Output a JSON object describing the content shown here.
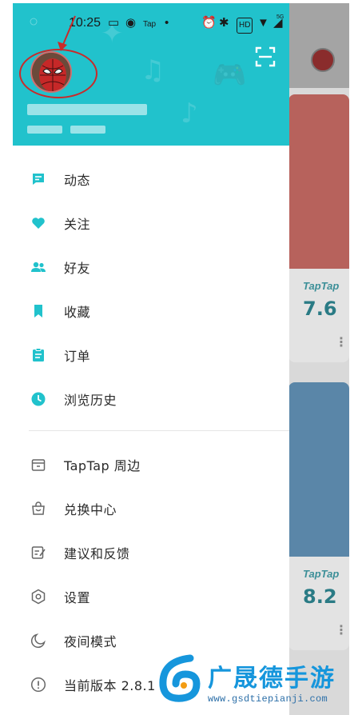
{
  "status_bar": {
    "time": "10:25",
    "app_badge": "Tap",
    "network_badge": "HD",
    "signal_label": "5G",
    "battery": "90%"
  },
  "drawer": {
    "header_color": "#21c2cc",
    "accent_color": "#21c2cc",
    "scan_icon": "scan-icon",
    "annotation_color": "#c92a2a",
    "menu": [
      {
        "label": "动态",
        "icon": "feed-icon"
      },
      {
        "label": "关注",
        "icon": "heart-icon"
      },
      {
        "label": "好友",
        "icon": "friends-icon"
      },
      {
        "label": "收藏",
        "icon": "bookmark-icon"
      },
      {
        "label": "订单",
        "icon": "order-icon"
      },
      {
        "label": "浏览历史",
        "icon": "clock-icon"
      },
      {
        "label": "TapTap 周边",
        "icon": "store-icon"
      },
      {
        "label": "兑换中心",
        "icon": "bag-icon"
      },
      {
        "label": "建议和反馈",
        "icon": "feedback-icon"
      },
      {
        "label": "设置",
        "icon": "settings-icon"
      },
      {
        "label": "夜间模式",
        "icon": "moon-icon"
      },
      {
        "label": "当前版本 2.8.1",
        "icon": "info-icon"
      }
    ]
  },
  "background_app": {
    "cards": [
      {
        "brand": "TapTap",
        "score": "7.6"
      },
      {
        "brand": "TapTap",
        "score": "8.2"
      }
    ]
  },
  "watermark": {
    "title": "广晟德手游",
    "url": "www.gsdtiepianji.com"
  }
}
